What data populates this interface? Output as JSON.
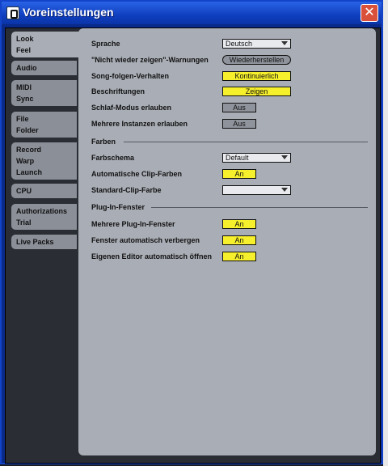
{
  "window": {
    "title": "Voreinstellungen"
  },
  "sidebar": {
    "tabs": [
      {
        "lines": [
          "Look",
          "Feel"
        ]
      },
      {
        "lines": [
          "Audio"
        ]
      },
      {
        "lines": [
          "MIDI",
          "Sync"
        ]
      },
      {
        "lines": [
          "File",
          "Folder"
        ]
      },
      {
        "lines": [
          "Record",
          "Warp",
          "Launch"
        ]
      },
      {
        "lines": [
          "CPU"
        ]
      },
      {
        "lines": [
          "Authorizations",
          "Trial"
        ]
      },
      {
        "lines": [
          "Live Packs"
        ]
      }
    ]
  },
  "settings": {
    "sprache": {
      "label": "Sprache",
      "value": "Deutsch"
    },
    "warnungen": {
      "label": "\"Nicht wieder zeigen\"-Warnungen",
      "value": "Wiederherstellen"
    },
    "song_folgen": {
      "label": "Song-folgen-Verhalten",
      "value": "Kontinuierlich"
    },
    "beschriftungen": {
      "label": "Beschriftungen",
      "value": "Zeigen"
    },
    "schlaf_modus": {
      "label": "Schlaf-Modus erlauben",
      "value": "Aus"
    },
    "mehrere_instanzen": {
      "label": "Mehrere Instanzen erlauben",
      "value": "Aus"
    }
  },
  "farben": {
    "header": "Farben",
    "farbschema": {
      "label": "Farbschema",
      "value": "Default"
    },
    "auto_clip_farben": {
      "label": "Automatische Clip-Farben",
      "value": "An"
    },
    "standard_clip_farbe": {
      "label": "Standard-Clip-Farbe",
      "value": ""
    }
  },
  "plugin": {
    "header": "Plug-In-Fenster",
    "mehrere_fenster": {
      "label": "Mehrere Plug-In-Fenster",
      "value": "An"
    },
    "auto_verbergen": {
      "label": "Fenster automatisch verbergen",
      "value": "An"
    },
    "editor_oeffnen": {
      "label": "Eigenen Editor automatisch öffnen",
      "value": "An"
    }
  },
  "colors": {
    "accent_yellow": "#f5ef2c",
    "panel_grey": "#a9adb5",
    "titlebar_blue": "#0f3fbf"
  }
}
